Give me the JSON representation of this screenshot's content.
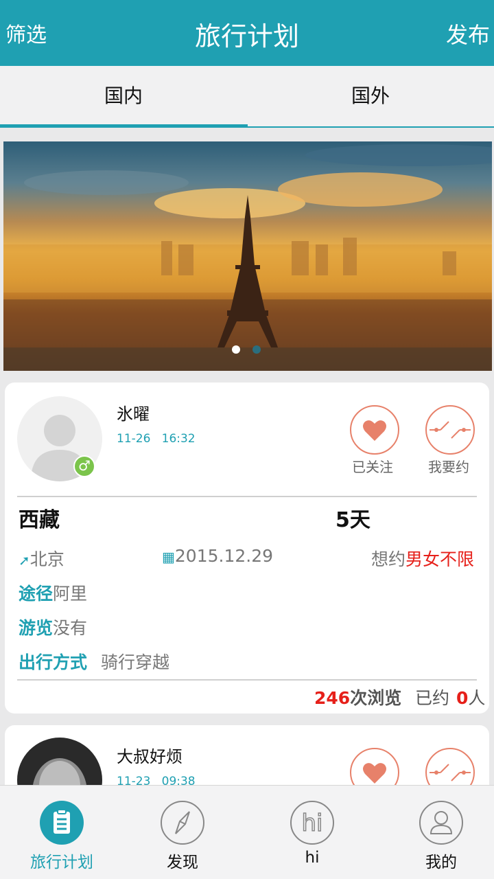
{
  "header": {
    "filter_label": "筛选",
    "title": "旅行计划",
    "publish_label": "发布"
  },
  "tabs": [
    {
      "label": "国内",
      "active": true
    },
    {
      "label": "国外",
      "active": false
    }
  ],
  "banner": {
    "dots": 2,
    "active_dot": 1
  },
  "posts": [
    {
      "user_name": "氷曜",
      "gender_icon": "male-icon",
      "date": "11-26",
      "time": "16:32",
      "follow_label": "已关注",
      "invite_label": "我要约",
      "destination": "西藏",
      "duration": "5天",
      "origin": "北京",
      "start_date": "2015.12.29",
      "want_prefix": "想约",
      "want_value": "男女不限",
      "route_key": "途径",
      "route_value": "阿里",
      "visit_key": "游览",
      "visit_value": "没有",
      "mode_key": "出行方式",
      "mode_value": "骑行穿越",
      "views_count": "246",
      "views_suffix": "次浏览",
      "booked_prefix": "已约",
      "booked_count": "0",
      "booked_suffix": "人"
    },
    {
      "user_name": "大叔好烦",
      "date": "11-23",
      "time": "09:38"
    }
  ],
  "bottom_nav": [
    {
      "label": "旅行计划",
      "icon": "clipboard-icon",
      "active": true
    },
    {
      "label": "发现",
      "icon": "compass-icon",
      "active": false
    },
    {
      "label": "hi",
      "icon": "hi-icon",
      "active": false
    },
    {
      "label": "我的",
      "icon": "person-icon",
      "active": false
    }
  ],
  "colors": {
    "accent": "#1fa0b2",
    "highlight_red": "#e6201a",
    "heart": "#e7816a"
  }
}
